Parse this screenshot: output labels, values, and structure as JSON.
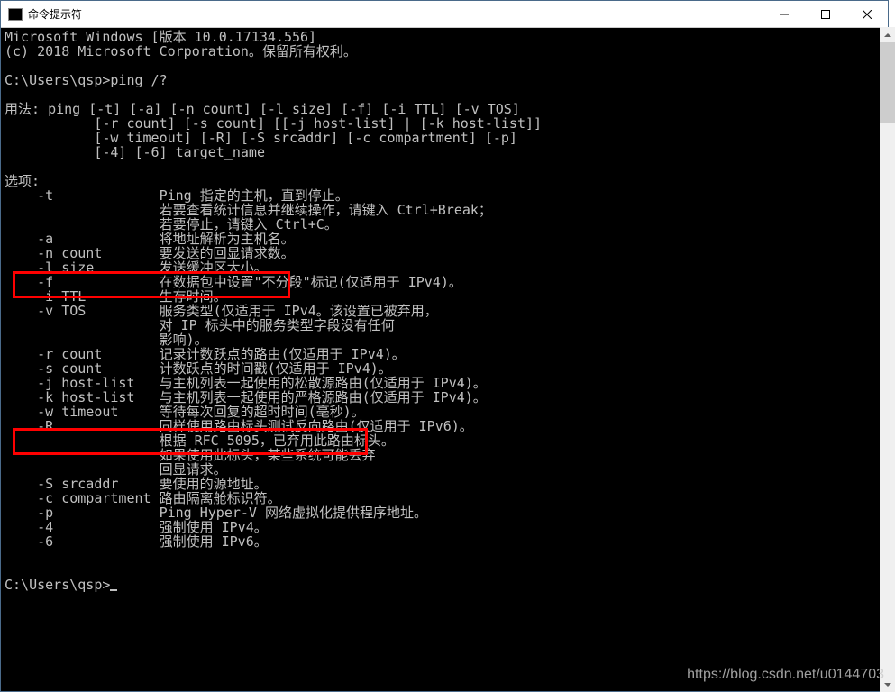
{
  "window": {
    "title": "命令提示符",
    "icon_label": "C:\\"
  },
  "terminal": {
    "header1": "Microsoft Windows [版本 10.0.17134.556]",
    "header2": "(c) 2018 Microsoft Corporation。保留所有权利。",
    "prompt1": "C:\\Users\\qsp>ping /?",
    "usage_label": "用法: ",
    "usage_line1": "ping [-t] [-a] [-n count] [-l size] [-f] [-i TTL] [-v TOS]",
    "usage_line2": "           [-r count] [-s count] [[-j host-list] | [-k host-list]]",
    "usage_line3": "           [-w timeout] [-R] [-S srcaddr] [-c compartment] [-p]",
    "usage_line4": "           [-4] [-6] target_name",
    "options_label": "选项:",
    "opt_t": "    -t             Ping 指定的主机，直到停止。",
    "opt_t2": "                   若要查看统计信息并继续操作，请键入 Ctrl+Break；",
    "opt_t3": "                   若要停止，请键入 Ctrl+C。",
    "opt_a": "    -a             将地址解析为主机名。",
    "opt_n": "    -n count       要发送的回显请求数。",
    "opt_l": "    -l size        发送缓冲区大小。",
    "opt_f": "    -f             在数据包中设置\"不分段\"标记(仅适用于 IPv4)。",
    "opt_i": "    -i TTL         生存时间。",
    "opt_v": "    -v TOS         服务类型(仅适用于 IPv4。该设置已被弃用，",
    "opt_v2": "                   对 IP 标头中的服务类型字段没有任何",
    "opt_v3": "                   影响)。",
    "opt_r": "    -r count       记录计数跃点的路由(仅适用于 IPv4)。",
    "opt_s": "    -s count       计数跃点的时间戳(仅适用于 IPv4)。",
    "opt_j": "    -j host-list   与主机列表一起使用的松散源路由(仅适用于 IPv4)。",
    "opt_k": "    -k host-list   与主机列表一起使用的严格源路由(仅适用于 IPv4)。",
    "opt_w": "    -w timeout     等待每次回复的超时时间(毫秒)。",
    "opt_R": "    -R             同样使用路由标头测试反向路由(仅适用于 IPv6)。",
    "opt_R2": "                   根据 RFC 5095，已弃用此路由标头。",
    "opt_R3": "                   如果使用此标头，某些系统可能丢弃",
    "opt_R4": "                   回显请求。",
    "opt_S": "    -S srcaddr     要使用的源地址。",
    "opt_c": "    -c compartment 路由隔离舱标识符。",
    "opt_p": "    -p             Ping Hyper-V 网络虚拟化提供程序地址。",
    "opt_4": "    -4             强制使用 IPv4。",
    "opt_6": "    -6             强制使用 IPv6。",
    "prompt2": "C:\\Users\\qsp>"
  },
  "watermark": "https://blog.csdn.net/u0144703"
}
